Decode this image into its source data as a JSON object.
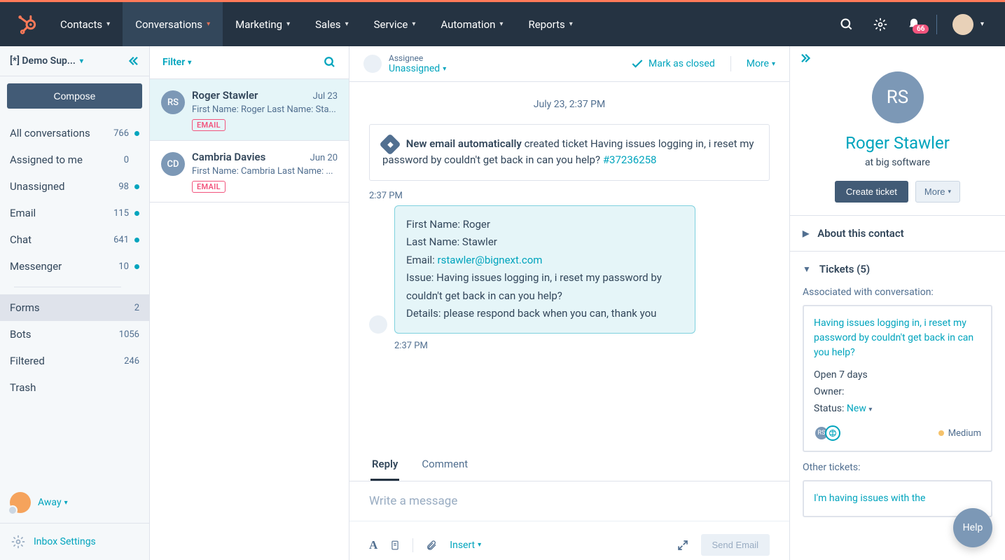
{
  "topnav": {
    "items": [
      "Contacts",
      "Conversations",
      "Marketing",
      "Sales",
      "Service",
      "Automation",
      "Reports"
    ],
    "active_index": 1,
    "notif_count": "66"
  },
  "sidebar": {
    "inbox_name": "[*] Demo Sup...",
    "compose": "Compose",
    "views": [
      {
        "label": "All conversations",
        "count": "766",
        "dot": true
      },
      {
        "label": "Assigned to me",
        "count": "0",
        "dot": false
      },
      {
        "label": "Unassigned",
        "count": "98",
        "dot": true
      },
      {
        "label": "Email",
        "count": "115",
        "dot": true
      },
      {
        "label": "Chat",
        "count": "641",
        "dot": true
      },
      {
        "label": "Messenger",
        "count": "10",
        "dot": true
      }
    ],
    "views2": [
      {
        "label": "Forms",
        "count": "2",
        "active": true
      },
      {
        "label": "Bots",
        "count": "1056"
      },
      {
        "label": "Filtered",
        "count": "246"
      },
      {
        "label": "Trash",
        "count": ""
      }
    ],
    "status": "Away",
    "settings": "Inbox Settings"
  },
  "convlist": {
    "filter": "Filter",
    "items": [
      {
        "initials": "RS",
        "name": "Roger Stawler",
        "date": "Jul 23",
        "preview": "First Name: Roger Last Name: Sta...",
        "badge": "EMAIL",
        "selected": true
      },
      {
        "initials": "CD",
        "name": "Cambria Davies",
        "date": "Jun 20",
        "preview": "First Name: Cambria Last Name: ...",
        "badge": "EMAIL",
        "selected": false
      }
    ]
  },
  "thread": {
    "assignee_label": "Assignee",
    "assignee_value": "Unassigned",
    "mark_closed": "Mark as closed",
    "more": "More",
    "date_full": "July 23, 2:37 PM",
    "ticket_prefix_bold": "New email automatically",
    "ticket_mid": "created ticket",
    "ticket_text": "Having issues logging in, i reset my password by couldn't get back in can you help?",
    "ticket_number": "#37236258",
    "msg_time": "2:37 PM",
    "msg": {
      "first": "First Name: Roger",
      "last": "Last Name: Stawler",
      "email_label": "Email: ",
      "email_value": "rstawler@bignext.com",
      "issue": "Issue: Having issues logging in, i reset my password by couldn't get back in can you help?",
      "details": "Details: please respond back when you can, thank you"
    },
    "msg_time2": "2:37 PM",
    "tabs": [
      "Reply",
      "Comment"
    ],
    "composer_placeholder": "Write a message",
    "insert": "Insert",
    "send": "Send Email"
  },
  "rpanel": {
    "initials": "RS",
    "name": "Roger Stawler",
    "sub": "at big software",
    "create_ticket": "Create ticket",
    "more": "More",
    "about": "About this contact",
    "tickets_header": "Tickets (5)",
    "assoc": "Associated with conversation:",
    "ticket": {
      "title": "Having issues logging in, i reset my password by couldn't get back in can you help?",
      "open": "Open 7 days",
      "owner": "Owner:",
      "status_label": "Status: ",
      "status_value": "New",
      "priority": "Medium"
    },
    "other": "Other tickets:",
    "other_ticket_title": "I'm having issues with the"
  },
  "help": "Help"
}
